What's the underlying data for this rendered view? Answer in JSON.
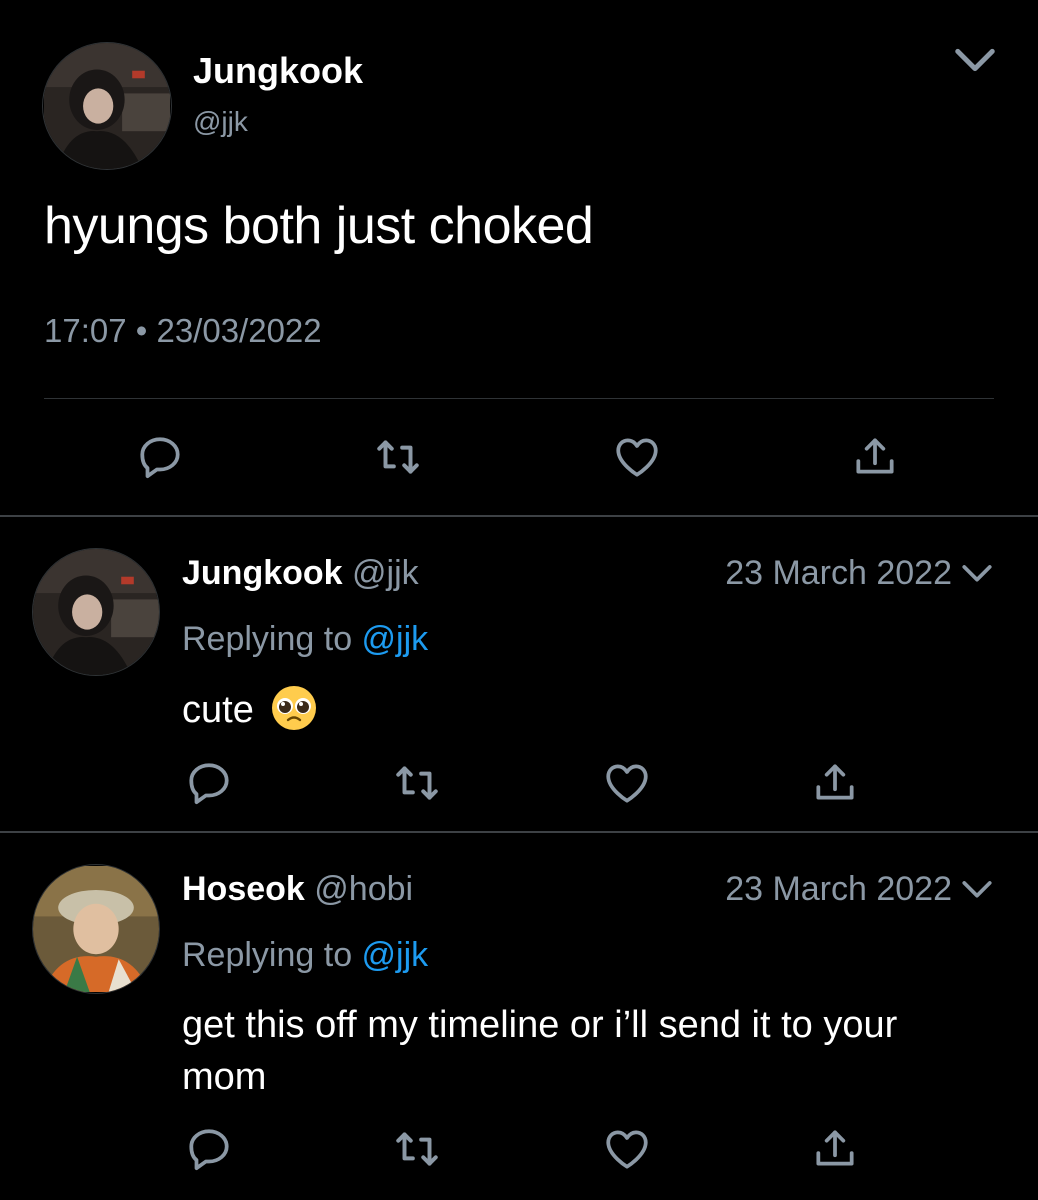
{
  "main_tweet": {
    "author": {
      "name": "Jungkook",
      "handle": "@jjk"
    },
    "text": "hyungs both just choked",
    "timestamp": "17:07 • 23/03/2022",
    "menu_icon": "chevron-down-icon"
  },
  "actions": {
    "icons": [
      "reply-icon",
      "retweet-icon",
      "like-icon",
      "share-icon"
    ],
    "stroke_color": "#8b98a5"
  },
  "replies": [
    {
      "name": "Jungkook",
      "handle": "@jjk",
      "date": "23 March 2022",
      "replying_prefix": "Replying to ",
      "replying_to": "@jjk",
      "text": "cute",
      "emoji": "pleading-face"
    },
    {
      "name": "Hoseok",
      "handle": "@hobi",
      "date": "23 March 2022",
      "replying_prefix": "Replying to ",
      "replying_to": "@jjk",
      "text": "get this off my timeline or i’ll send it to your mom"
    }
  ],
  "colors": {
    "background": "#000000",
    "text_primary": "#ffffff",
    "text_secondary": "#8b98a5",
    "link": "#1d9bf0",
    "divider": "#2f3336"
  }
}
